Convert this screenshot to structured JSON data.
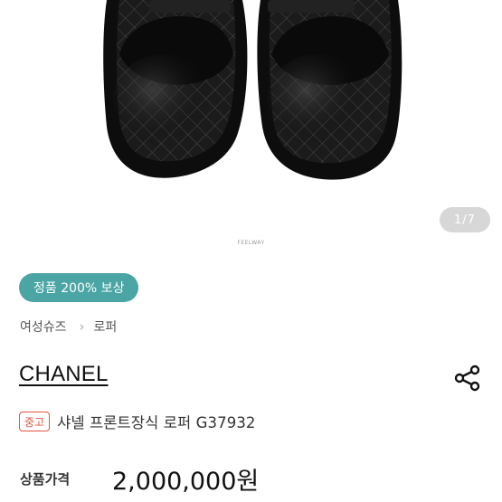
{
  "gallery": {
    "watermark": "FEELWAY",
    "page_indicator": "1/7",
    "image_icon": "loafer-shoes-photo"
  },
  "product": {
    "auth_badge": "정품 200% 보상",
    "breadcrumb": [
      "여성슈즈",
      "로퍼"
    ],
    "brand": "CHANEL",
    "condition_badge": "중고",
    "title": "샤넬 프론트장식 로퍼 G37932",
    "price_label": "상품가격",
    "price": "2,000,000원"
  },
  "icons": {
    "share": "share-icon",
    "breadcrumb_separator": "chevron-right-icon"
  },
  "colors": {
    "auth_badge_bg": "#4aa5a4",
    "condition_badge": "#e0553f",
    "indicator_bg": "#d7d7d7"
  }
}
